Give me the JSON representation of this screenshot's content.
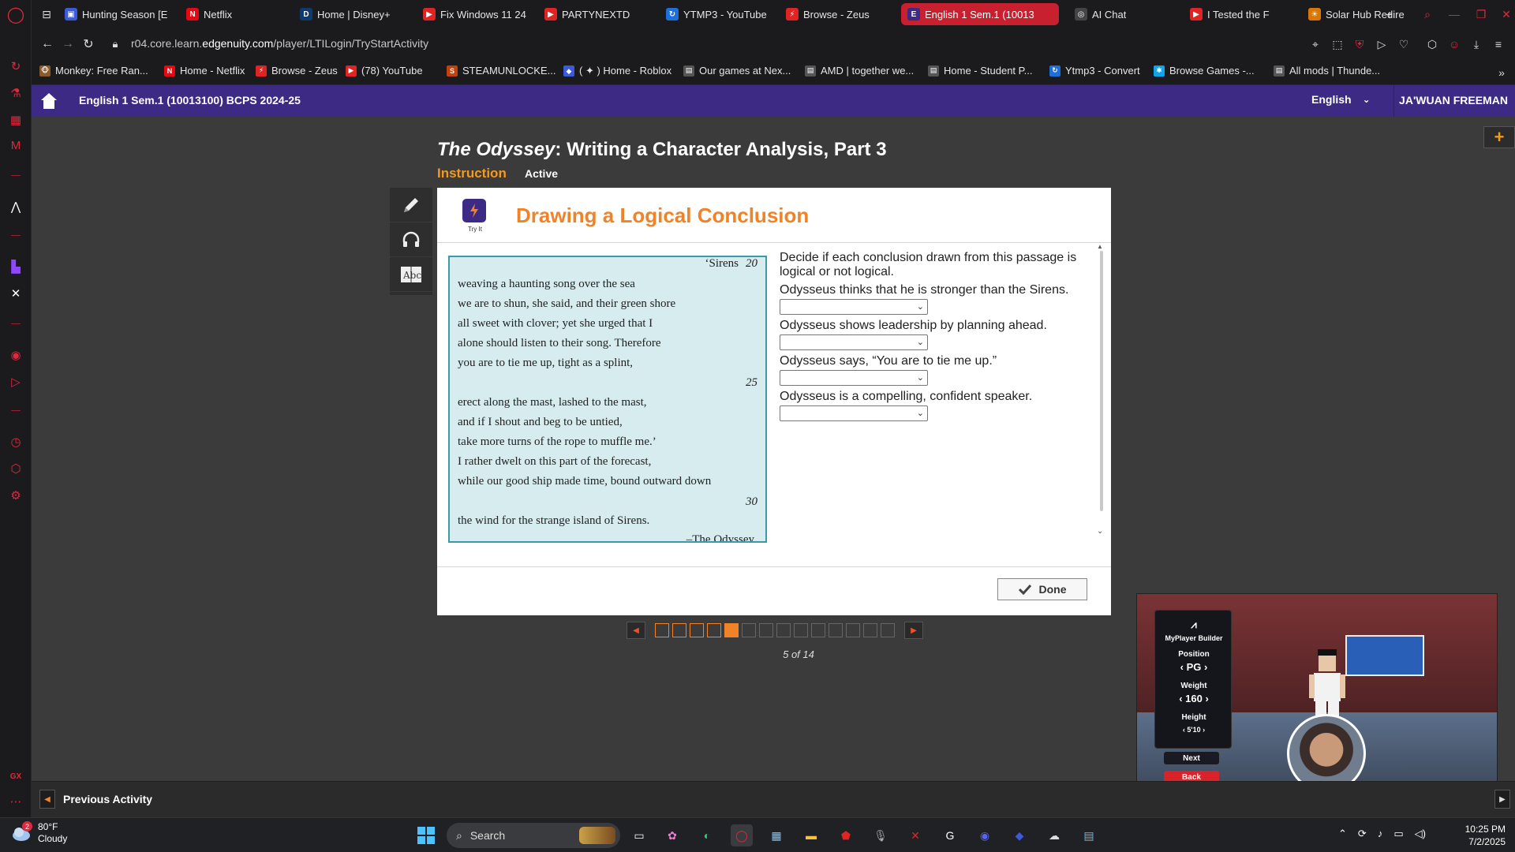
{
  "browser": {
    "tabs": [
      {
        "title": "Hunting Season [E",
        "fav_color": "#3b5bdb",
        "fav_glyph": "▣"
      },
      {
        "title": "Netflix",
        "fav_color": "#e50914",
        "fav_glyph": "N"
      },
      {
        "title": "Home | Disney+",
        "fav_color": "#0e3a6e",
        "fav_glyph": "D"
      },
      {
        "title": "Fix Windows 11 24",
        "fav_color": "#e02424",
        "fav_glyph": "▶"
      },
      {
        "title": "PARTYNEXTD",
        "fav_color": "#e02424",
        "fav_glyph": "▶"
      },
      {
        "title": "YTMP3 - YouTube",
        "fav_color": "#1e6fd9",
        "fav_glyph": "↻"
      },
      {
        "title": "Browse - Zeus",
        "fav_color": "#e02424",
        "fav_glyph": "⚡"
      },
      {
        "title": "English 1 Sem.1 (10013",
        "fav_color": "#3c2a84",
        "fav_glyph": "E"
      },
      {
        "title": "AI Chat",
        "fav_color": "#444",
        "fav_glyph": "◎"
      },
      {
        "title": "I Tested the F",
        "fav_color": "#e02424",
        "fav_glyph": "▶"
      },
      {
        "title": "Solar Hub Redirec",
        "fav_color": "#d97706",
        "fav_glyph": "☀"
      }
    ],
    "new_tab": "+",
    "url_prefix": "r04.core.learn.",
    "url_domain": "edgenuity.com",
    "url_path": "/player/LTILogin/TryStartActivity",
    "bookmarks": [
      {
        "label": "Monkey: Free Ran...",
        "fav_color": "#8b5a2b",
        "fav_glyph": "🐵"
      },
      {
        "label": "Home - Netflix",
        "fav_color": "#e50914",
        "fav_glyph": "N"
      },
      {
        "label": "Browse - Zeus",
        "fav_color": "#e02424",
        "fav_glyph": "⚡"
      },
      {
        "label": "(78) YouTube",
        "fav_color": "#e02424",
        "fav_glyph": "▶"
      },
      {
        "label": "STEAMUNLOCKE...",
        "fav_color": "#c2410c",
        "fav_glyph": "S"
      },
      {
        "label": "( ✦ ) Home - Roblox",
        "fav_color": "#3b5bdb",
        "fav_glyph": "◆"
      },
      {
        "label": "Our games at Nex...",
        "fav_color": "#555",
        "fav_glyph": "▤"
      },
      {
        "label": "AMD | together we...",
        "fav_color": "#555",
        "fav_glyph": "▤"
      },
      {
        "label": "Home - Student P...",
        "fav_color": "#555",
        "fav_glyph": "▤"
      },
      {
        "label": "Ytmp3 - Convert",
        "fav_color": "#1e6fd9",
        "fav_glyph": "↻"
      },
      {
        "label": "Browse Games -...",
        "fav_color": "#0ea5e9",
        "fav_glyph": "✱"
      },
      {
        "label": "All mods | Thunde...",
        "fav_color": "#555",
        "fav_glyph": "▤"
      }
    ]
  },
  "header": {
    "course_title": "English 1 Sem.1 (10013100) BCPS 2024-25",
    "language": "English",
    "user": "JA'WUAN FREEMAN"
  },
  "activity": {
    "title_italic": "The Odyssey",
    "title_rest": ": Writing a Character Analysis, Part 3",
    "tab_instruction": "Instruction",
    "tab_active": "Active",
    "try_it_label": "Try It",
    "card_title": "Drawing a Logical Conclusion",
    "passage": {
      "top_right": "‘Sirens",
      "num_20": "20",
      "lines_a": [
        "weaving a haunting song over the sea",
        "we are to shun, she said, and their green shore",
        "all sweet with clover; yet she urged that I",
        "alone should listen to their song. Therefore",
        "you are to tie me up, tight as a splint,"
      ],
      "num_25": "25",
      "lines_b": [
        "erect along the mast, lashed to the mast,",
        "and if I shout and beg to be untied,",
        "take more turns of the rope to muffle me.’",
        "I rather dwelt on this part of the forecast,",
        "while our good ship made time, bound outward down"
      ],
      "num_30": "30",
      "lines_c": [
        "the wind for the strange island of Sirens."
      ],
      "attribution": "–The Odyssey"
    },
    "intro": "Decide if each conclusion drawn from this passage is logical or not logical.",
    "questions": [
      {
        "text": "Odysseus thinks that he is stronger than the Sirens.",
        "selected": ""
      },
      {
        "text": "Odysseus shows leadership by planning ahead.",
        "selected": ""
      },
      {
        "text": "Odysseus says, “You are to tie me up.”",
        "selected": ""
      },
      {
        "text": "Odysseus is a compelling, confident speaker.",
        "selected": ""
      }
    ],
    "done_label": "Done",
    "pager": {
      "current": 5,
      "total": 14,
      "label": "5 of 14"
    },
    "previous_activity": "Previous Activity"
  },
  "overlay": {
    "panel_title": "MyPlayer Builder",
    "position_label": "Position",
    "position_value": "PG",
    "weight_label": "Weight",
    "weight_value": "160",
    "height_label": "Height",
    "height_value": "5'10",
    "next": "Next",
    "back": "Back"
  },
  "taskbar": {
    "weather_temp": "80°F",
    "weather_desc": "Cloudy",
    "weather_badge": "2",
    "search": "Search",
    "time": "10:25 PM",
    "date": "7/2/2025"
  },
  "colors": {
    "header_purple": "#3c2a84",
    "accent_orange": "#f08228",
    "opera_red": "#e0283f"
  }
}
